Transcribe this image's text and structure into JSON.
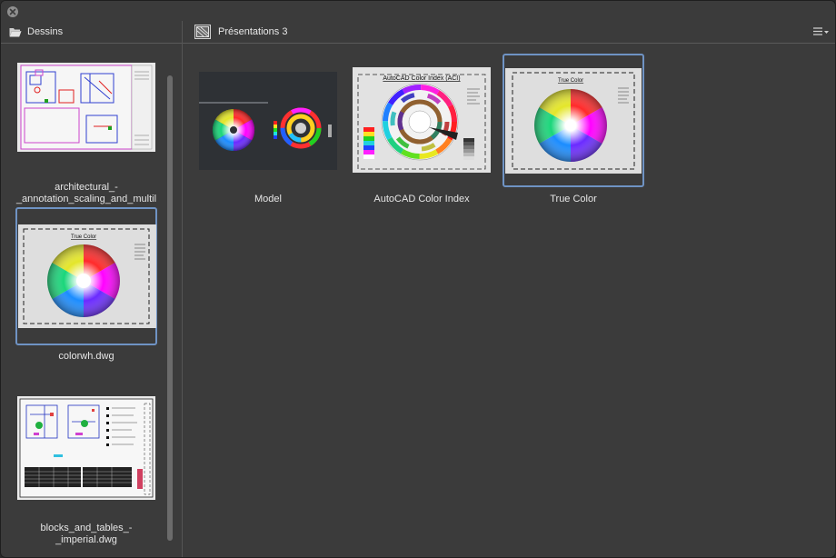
{
  "window": {
    "close_label": "close"
  },
  "left_panel": {
    "title": "Dessins",
    "items": [
      {
        "name_line1": "architectural_-",
        "name_line2": "_annotation_scaling_and_multil",
        "selected": false
      },
      {
        "name_line1": "colorwh.dwg",
        "name_line2": "",
        "selected": true
      },
      {
        "name_line1": "blocks_and_tables_-",
        "name_line2": "_imperial.dwg",
        "selected": false
      }
    ]
  },
  "right_panel": {
    "title": "Présentations 3",
    "layouts": [
      {
        "label": "Model",
        "selected": false
      },
      {
        "label": "AutoCAD Color Index",
        "selected": false,
        "thumb_title": "AutoCAD Color Index (ACI)"
      },
      {
        "label": "True Color",
        "selected": true,
        "thumb_title": "True Color"
      }
    ]
  },
  "colors": {
    "background": "#3b3b3b",
    "selection": "#6f93c4",
    "paper": "#dcdcdc",
    "model_bg": "#2e3135"
  }
}
